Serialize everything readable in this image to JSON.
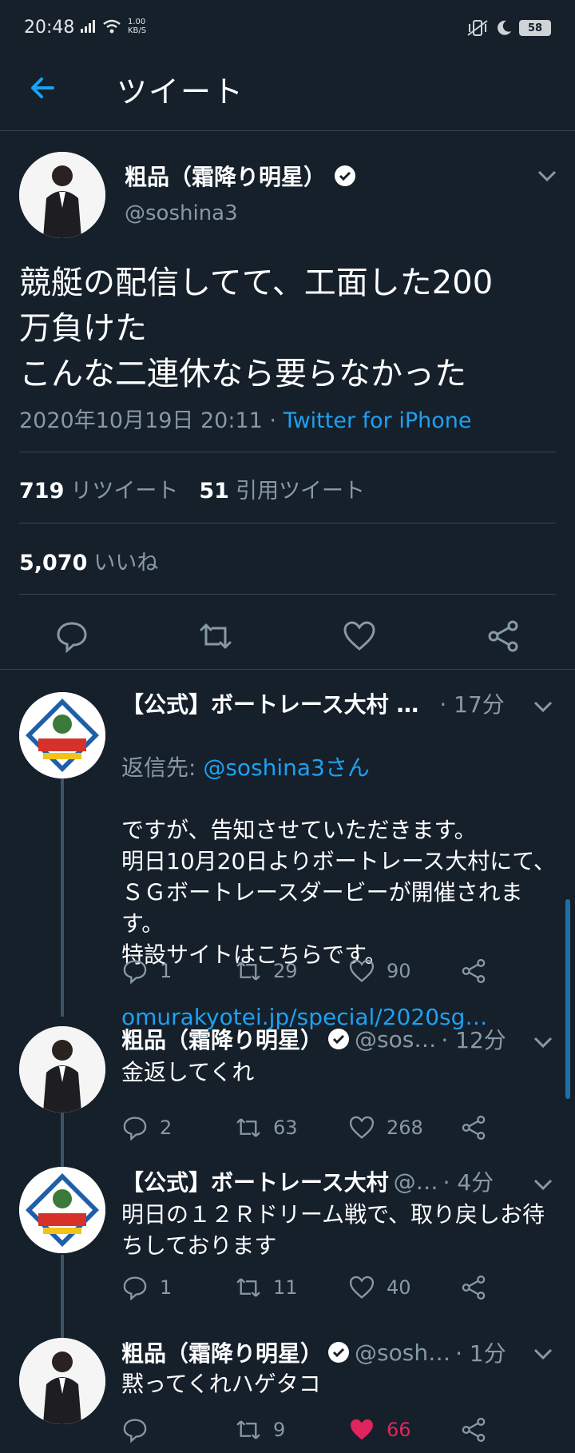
{
  "status_bar": {
    "time": "20:48",
    "speed_value": "1.00",
    "speed_unit": "KB/S",
    "battery": "58"
  },
  "header": {
    "title": "ツイート",
    "back_icon": "arrow-left-icon"
  },
  "main_tweet": {
    "name": "粗品（霜降り明星）",
    "handle": "@soshina3",
    "text": "競艇の配信してて、工面した200\n万負けた\nこんな二連休なら要らなかった",
    "date": "2020年10月19日 20:11",
    "separator": " · ",
    "source": "Twitter for iPhone",
    "retweets_count": "719",
    "retweets_label": "リツイート",
    "quotes_count": "51",
    "quotes_label": "引用ツイート",
    "likes_count": "5,070",
    "likes_label": "いいね"
  },
  "replies": [
    {
      "name": "【公式】ボートレース大村 …",
      "handle": "",
      "time": "· 17分",
      "reply_to_prefix": "返信先: ",
      "reply_to_user": "@soshina3さん",
      "text": "ですが、告知させていただきます。\n明日10月20日よりボートレース大村にて、ＳＧボートレースダービーが開催されます。\n特設サイトはこちらです。",
      "link": "omurakyotei.jp/special/2020sg…",
      "reply_count": "1",
      "retweet_count": "29",
      "like_count": "90"
    },
    {
      "name": "粗品（霜降り明星）",
      "handle": "@sos…",
      "time": "· 12分",
      "text": "金返してくれ",
      "reply_count": "2",
      "retweet_count": "63",
      "like_count": "268"
    },
    {
      "name": "【公式】ボートレース大村",
      "handle": "@…",
      "time": "· 4分",
      "text": "明日の１２Ｒドリーム戦で、取り戻しお待ちしております",
      "reply_count": "1",
      "retweet_count": "11",
      "like_count": "40"
    },
    {
      "name": "粗品（霜降り明星）",
      "handle": "@sosh…",
      "time": "· 1分",
      "text": "黙ってくれハゲタコ",
      "reply_count": "",
      "retweet_count": "9",
      "like_count": "66",
      "liked": true
    }
  ],
  "colors": {
    "background": "#15202b",
    "accent": "#1da1f2",
    "muted": "#8899a6",
    "like": "#e0245e",
    "divider": "#38444d"
  }
}
